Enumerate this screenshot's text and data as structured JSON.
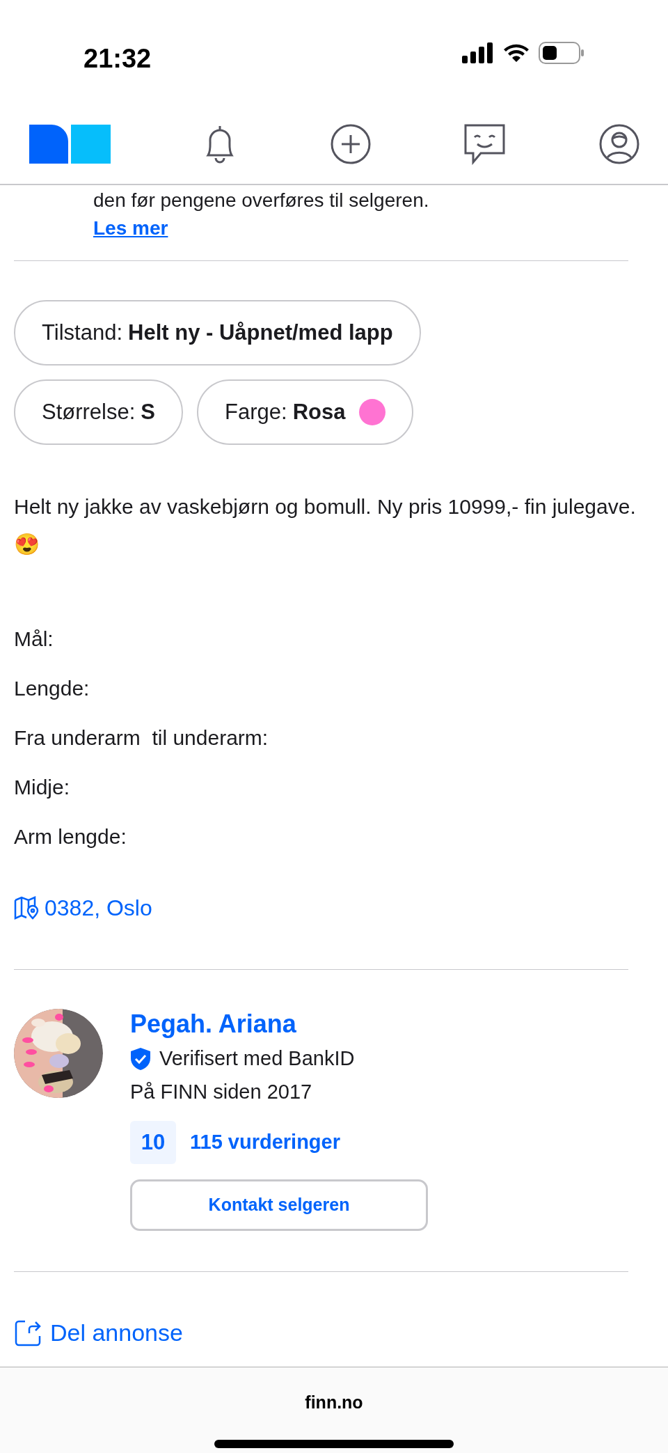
{
  "status_bar": {
    "time": "21:32"
  },
  "notice": {
    "text": "den før pengene overføres til selgeren.",
    "link": "Les mer"
  },
  "attributes": [
    {
      "label": "Tilstand:",
      "value": "Helt ny - Uåpnet/med lapp"
    },
    {
      "label": "Størrelse:",
      "value": "S"
    },
    {
      "label": "Farge:",
      "value": "Rosa",
      "color": "#ff73d2"
    }
  ],
  "description": "Helt ny jakke av vaskebjørn og bomull. Ny pris 10999,- fin julegave. 😍",
  "measurements": [
    "Mål:",
    "Lengde:",
    "Fra underarm  til underarm:",
    "Midje:",
    "Arm lengde:"
  ],
  "location": "0382, Oslo",
  "seller": {
    "name": "Pegah. Ariana",
    "verified": "Verifisert med BankID",
    "member_since": "På FINN siden 2017",
    "score": "10",
    "reviews": "115 vurderinger",
    "contact_button": "Kontakt selgeren"
  },
  "share": "Del annonse",
  "browser": {
    "url": "finn.no"
  }
}
